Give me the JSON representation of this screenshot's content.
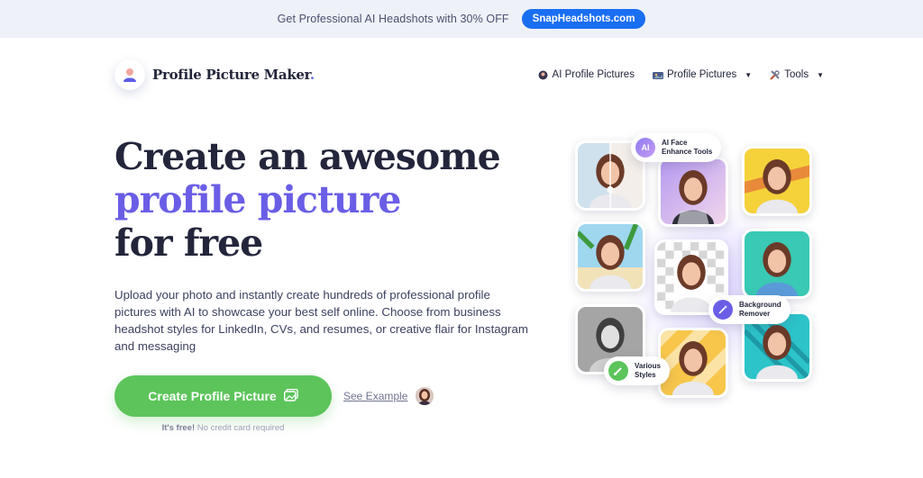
{
  "promo": {
    "text": "Get Professional AI Headshots with 30% OFF",
    "button": "SnapHeadshots.com"
  },
  "brand": {
    "name": "Profile Picture Maker",
    "dot": "."
  },
  "nav": [
    {
      "label": "AI Profile Pictures",
      "icon": "ai-avatar-icon",
      "dropdown": false
    },
    {
      "label": "Profile Pictures",
      "icon": "gallery-icon",
      "dropdown": true
    },
    {
      "label": "Tools",
      "icon": "tools-icon",
      "dropdown": true
    }
  ],
  "hero": {
    "line1": "Create an awesome",
    "line2": "profile picture",
    "line3": "for free",
    "description": "Upload your photo and instantly create hundreds of professional profile pictures with AI to showcase your best self online. Choose from business headshot styles for LinkedIn, CVs, and resumes, or creative flair for Instagram and messaging",
    "cta": "Create Profile Picture",
    "see_example": "See Example",
    "free_strong": "It's free!",
    "free_rest": "No credit card required"
  },
  "badges": {
    "ai": {
      "icon_text": "AI",
      "label": "AI Face\nEnhance Tools"
    },
    "bg": {
      "label": "Background\nRemover"
    },
    "styles": {
      "label": "Various\nStyles"
    }
  },
  "colors": {
    "accent": "#6a5ee6",
    "cta": "#5cc45a",
    "promo_button": "#1a6ef2"
  }
}
